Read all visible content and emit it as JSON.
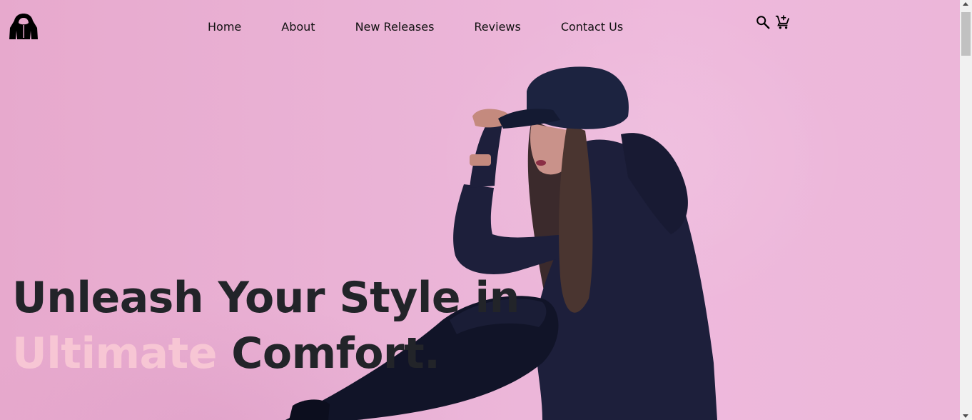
{
  "header": {
    "logo_icon": "hoodie-logo-icon",
    "nav": {
      "home": "Home",
      "about": "About",
      "new_releases": "New Releases",
      "reviews": "Reviews",
      "contact": "Contact Us"
    },
    "icons": {
      "search": "search-icon",
      "cart": "add-shopping-cart-icon"
    }
  },
  "hero": {
    "headline_line1": "Unleash Your Style in",
    "headline_accent": "Ultimate",
    "headline_rest": " Comfort.",
    "image": "model-in-cap-and-hoodie"
  },
  "colors": {
    "background": "#eab3d6",
    "headline": "#222429",
    "accent": "#f7c6d4",
    "nav_text": "#111111"
  }
}
